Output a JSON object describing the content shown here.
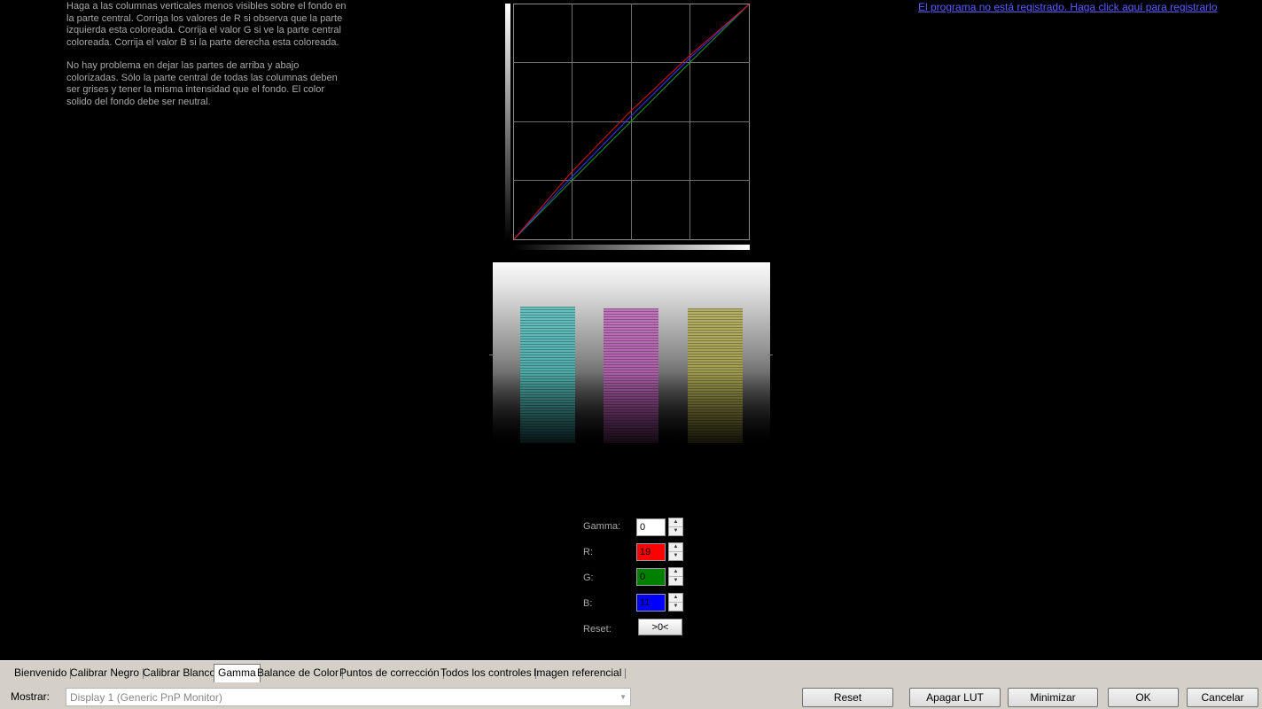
{
  "instructions": {
    "paragraph1": "Haga a las columnas verticales menos visibles sobre el fondo en la parte central. Corriga los valores de R si observa que la parte izquierda esta coloreada. Corrija el valor G si ve la parte central coloreada. Corrija el valor B si la parte derecha esta coloreada.",
    "paragraph2": "No hay problema en dejar las partes de arriba y abajo colorizadas. Sólo la parte central de todas las columnas deben ser grises y tener la misma intensidad que el fondo. El color solido del fondo debe ser neutral."
  },
  "register_link": "El programa no está registrado. Haga click aquí para registrarlo",
  "controls": {
    "gamma_label": "Gamma:",
    "gamma_value": "0",
    "r_label": "R:",
    "r_value": "19",
    "g_label": "G:",
    "g_value": "0",
    "b_label": "B:",
    "b_value": "11",
    "reset_label": "Reset:",
    "reset_button": ">0<",
    "r_color": "#ff0000",
    "g_color": "#008000",
    "b_color": "#0000ff"
  },
  "tabs": [
    {
      "label": "Bienvenido",
      "active": false
    },
    {
      "label": "Calibrar Negro",
      "active": false
    },
    {
      "label": "Calibrar Blanco",
      "active": false
    },
    {
      "label": "Gamma",
      "active": true
    },
    {
      "label": "Balance de Color",
      "active": false
    },
    {
      "label": "Puntos de corrección",
      "active": false
    },
    {
      "label": "Todos los controles",
      "active": false
    },
    {
      "label": "Imagen referencial",
      "active": false
    }
  ],
  "bottom": {
    "show_label": "Mostrar:",
    "display_value": "Display 1 (Generic PnP Monitor)",
    "reset": "Reset",
    "lut_off": "Apagar LUT",
    "minimize": "Minimizar",
    "ok": "OK",
    "cancel": "Cancelar"
  },
  "icons": {
    "spin_up": "▲",
    "spin_down": "▼",
    "dropdown": "▼"
  }
}
